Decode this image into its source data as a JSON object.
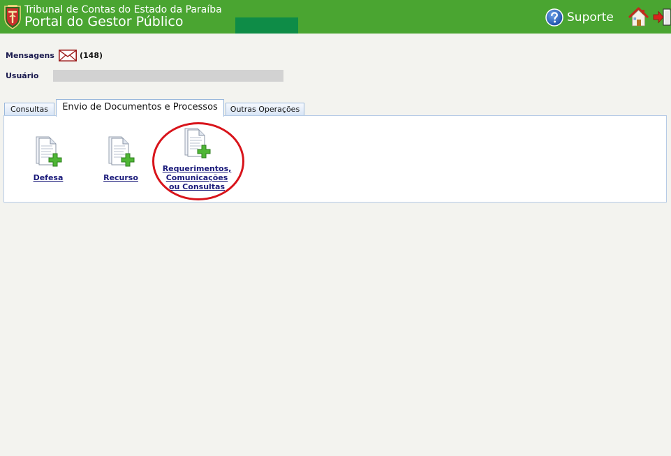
{
  "header": {
    "org_name": "Tribunal de Contas do Estado da Paraíba",
    "portal_name": "Portal do Gestor Público",
    "support_label": "Suporte",
    "support_icon": "question-circle-icon",
    "home_icon": "home-icon",
    "logout_icon": "logout-arrow-icon",
    "logo_icon": "tce-shield-logo",
    "colors": {
      "bar": "#4aa531",
      "block": "#0e8c47"
    }
  },
  "info": {
    "messages_label": "Mensagens",
    "messages_icon": "envelope-icon",
    "messages_count": "(148)",
    "user_label": "Usuário",
    "user_value": ""
  },
  "tabs": [
    {
      "label": "Consultas",
      "active": false
    },
    {
      "label": "Envio de Documentos e Processos",
      "active": true
    },
    {
      "label": "Outras Operações",
      "active": false
    }
  ],
  "panel": {
    "items": [
      {
        "label": "Defesa",
        "icon": "document-add-icon"
      },
      {
        "label": "Recurso",
        "icon": "document-add-icon"
      },
      {
        "label_lines": [
          "Requerimentos,",
          "Comunicações",
          "ou Consultas"
        ],
        "icon": "document-add-icon",
        "highlighted": true
      }
    ]
  },
  "colors": {
    "highlight": "#d8141b",
    "link": "#1a1a7a",
    "background": "#f3f3ef"
  }
}
